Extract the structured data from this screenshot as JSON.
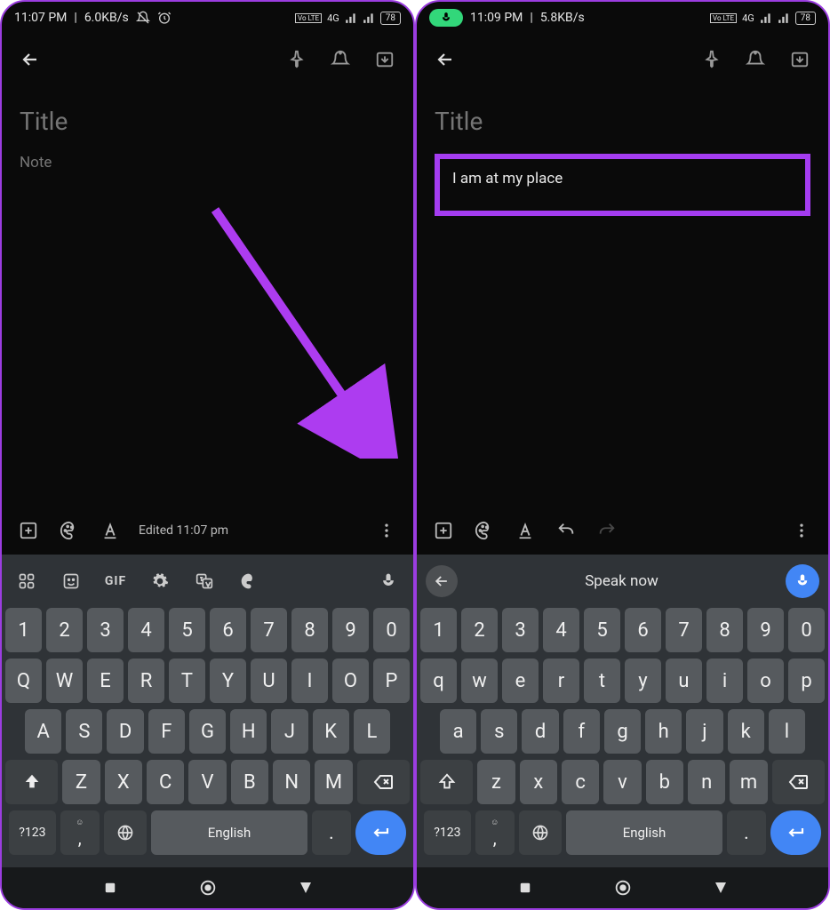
{
  "left": {
    "status": {
      "time": "11:07 PM",
      "net": "6.0KB/s",
      "battery": "78",
      "volte": "Vo LTE",
      "band": "4G"
    },
    "title_placeholder": "Title",
    "note_placeholder": "Note",
    "edited_label": "Edited 11:07 pm",
    "keyboard": {
      "gif": "GIF",
      "row_num": [
        "1",
        "2",
        "3",
        "4",
        "5",
        "6",
        "7",
        "8",
        "9",
        "0"
      ],
      "row1": [
        "Q",
        "W",
        "E",
        "R",
        "T",
        "Y",
        "U",
        "I",
        "O",
        "P"
      ],
      "row2": [
        "A",
        "S",
        "D",
        "F",
        "G",
        "H",
        "J",
        "K",
        "L"
      ],
      "row3": [
        "Z",
        "X",
        "C",
        "V",
        "B",
        "N",
        "M"
      ],
      "sym": "?123",
      "space": "English",
      "period": "."
    }
  },
  "right": {
    "status": {
      "time": "11:09 PM",
      "net": "5.8KB/s",
      "battery": "78",
      "volte": "Vo LTE",
      "band": "4G"
    },
    "title_placeholder": "Title",
    "note_text": "I am at my place",
    "speak": "Speak now",
    "keyboard": {
      "row_num": [
        "1",
        "2",
        "3",
        "4",
        "5",
        "6",
        "7",
        "8",
        "9",
        "0"
      ],
      "row1": [
        "q",
        "w",
        "e",
        "r",
        "t",
        "y",
        "u",
        "i",
        "o",
        "p"
      ],
      "row2": [
        "a",
        "s",
        "d",
        "f",
        "g",
        "h",
        "j",
        "k",
        "l"
      ],
      "row3": [
        "z",
        "x",
        "c",
        "v",
        "b",
        "n",
        "m"
      ],
      "sym": "?123",
      "space": "English",
      "period": "."
    }
  }
}
